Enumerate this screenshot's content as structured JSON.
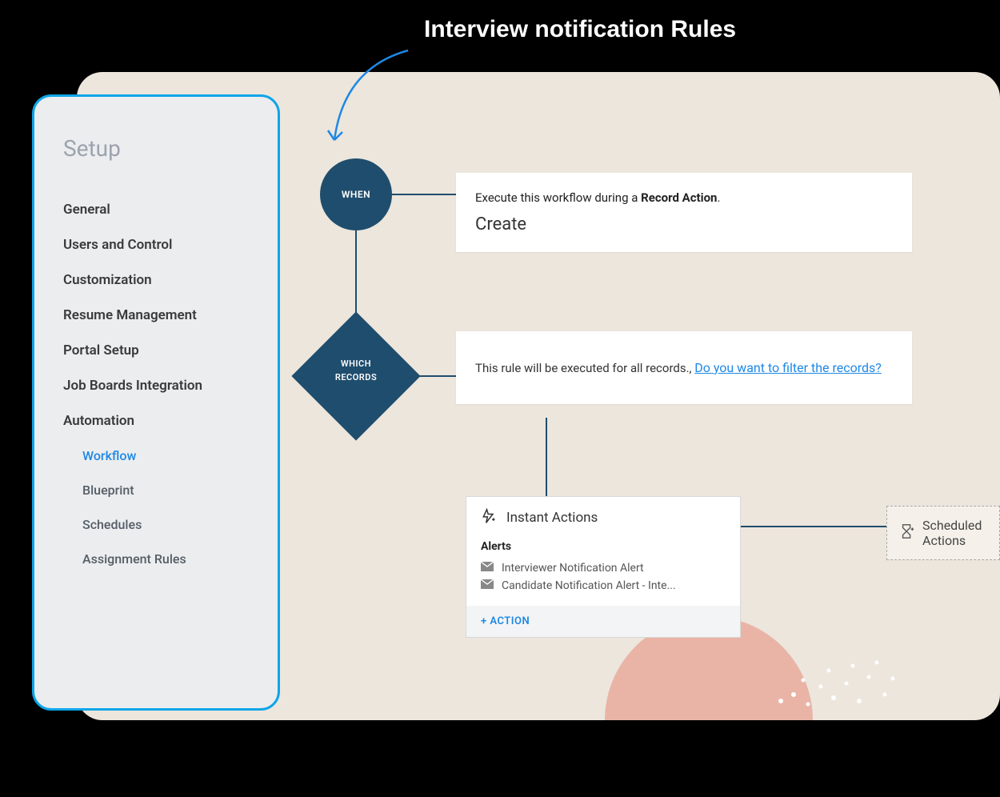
{
  "annotation": "Interview notification Rules",
  "sidebar": {
    "title": "Setup",
    "items": [
      {
        "label": "General"
      },
      {
        "label": "Users and Control"
      },
      {
        "label": "Customization"
      },
      {
        "label": "Resume Management"
      },
      {
        "label": "Portal Setup"
      },
      {
        "label": "Job Boards Integration"
      },
      {
        "label": "Automation"
      }
    ],
    "subitems": [
      {
        "label": "Workflow",
        "active": true
      },
      {
        "label": "Blueprint"
      },
      {
        "label": "Schedules"
      },
      {
        "label": "Assignment Rules"
      }
    ]
  },
  "flow": {
    "when": {
      "node_label": "WHEN",
      "text_prefix": "Execute this workflow during a ",
      "text_bold": "Record Action",
      "text_suffix": ".",
      "action": "Create"
    },
    "which": {
      "node_label": "WHICH\nRECORDS",
      "text": "This rule will be executed for all records., ",
      "link": "Do you want to filter the records?"
    },
    "instant": {
      "label": "Instant Actions",
      "alerts_title": "Alerts",
      "alerts": [
        "Interviewer Notification Alert",
        "Candidate Notification Alert - Inte..."
      ],
      "add_action": "+ ACTION"
    },
    "scheduled": {
      "label": "Scheduled Actions"
    }
  }
}
